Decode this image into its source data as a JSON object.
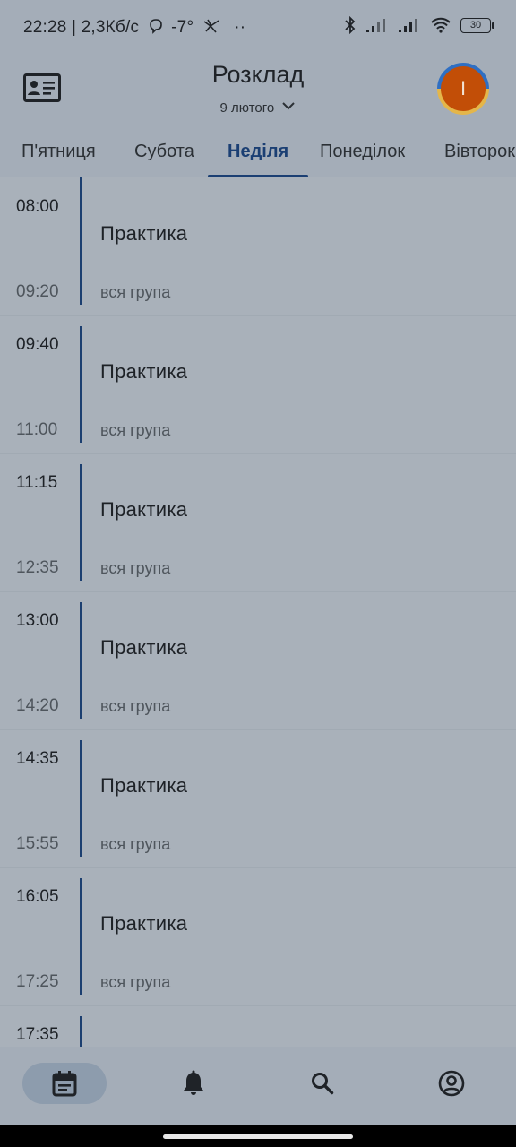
{
  "status_bar": {
    "text": "22:28 | 2,3Кб/с",
    "temperature": "-7°",
    "battery": "30"
  },
  "header": {
    "title": "Розклад",
    "date": "9 лютого",
    "avatar_letter": "I",
    "id_card_icon": "id-card-icon",
    "chevron_icon": "chevron-down-icon"
  },
  "tabs": [
    {
      "label": "П'ятниця"
    },
    {
      "label": "Субота"
    },
    {
      "label": "Неділя",
      "active": true
    },
    {
      "label": "Понеділок"
    },
    {
      "label": "Вівторок"
    }
  ],
  "lessons": [
    {
      "start": "08:00",
      "end": "09:20",
      "name": "Практика",
      "group": "вся група"
    },
    {
      "start": "09:40",
      "end": "11:00",
      "name": "Практика",
      "group": "вся група"
    },
    {
      "start": "11:15",
      "end": "12:35",
      "name": "Практика",
      "group": "вся група"
    },
    {
      "start": "13:00",
      "end": "14:20",
      "name": "Практика",
      "group": "вся група"
    },
    {
      "start": "14:35",
      "end": "15:55",
      "name": "Практика",
      "group": "вся група"
    },
    {
      "start": "16:05",
      "end": "17:25",
      "name": "Практика",
      "group": "вся група"
    },
    {
      "start": "17:35",
      "end": "",
      "name": "",
      "group": ""
    }
  ],
  "bottom_nav": [
    {
      "icon": "calendar-icon",
      "active": true
    },
    {
      "icon": "bell-icon"
    },
    {
      "icon": "search-icon"
    },
    {
      "icon": "account-icon"
    }
  ],
  "colors": {
    "accent": "#1b3f73",
    "avatar_bg": "#c24e07"
  }
}
